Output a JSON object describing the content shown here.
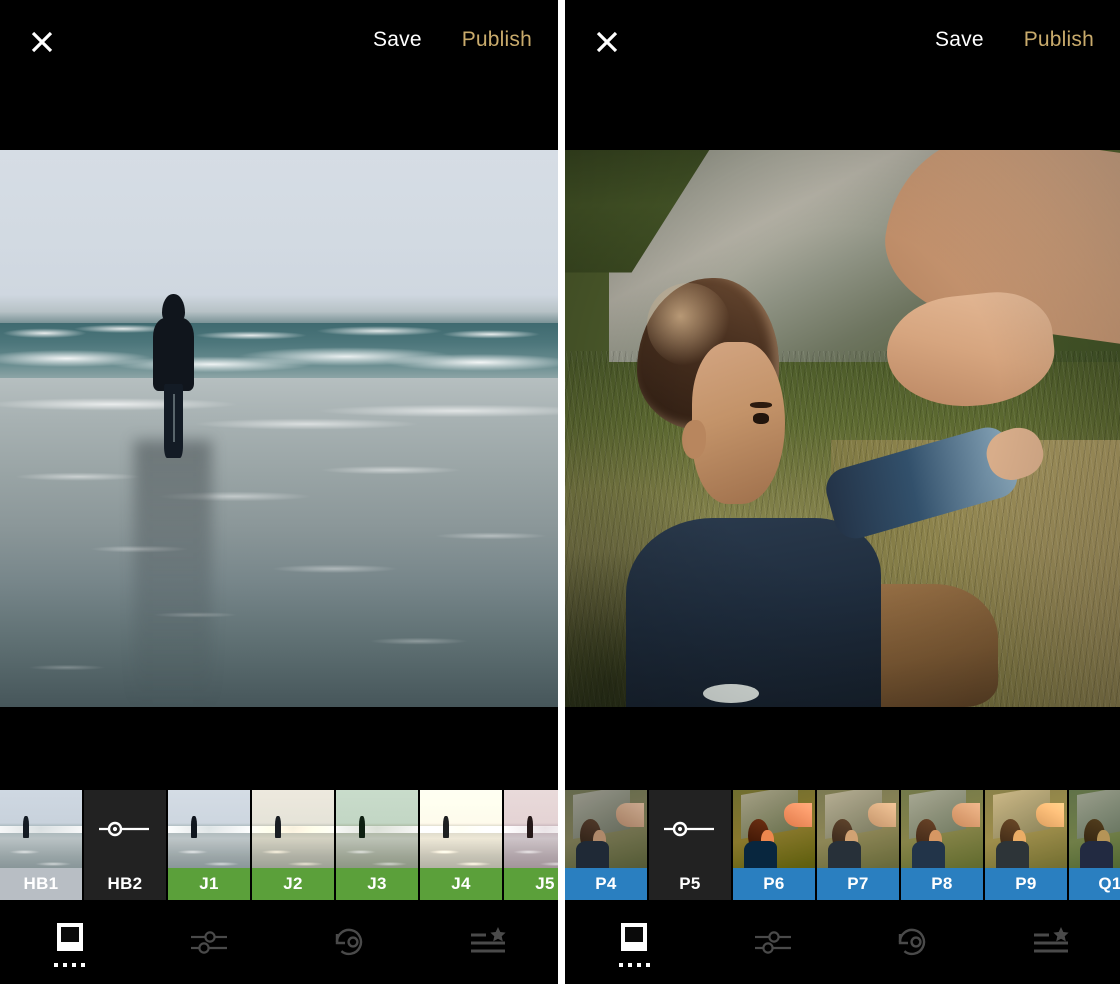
{
  "app": {
    "screens": [
      {
        "id": "screen-left",
        "header": {
          "close_icon": "close-icon",
          "save_label": "Save",
          "publish_label": "Publish"
        },
        "photo": {
          "subject": "person standing in ocean surf at beach",
          "type": "beach"
        },
        "filter_strip": {
          "tiles": [
            {
              "label": "HB1",
              "style": "selected",
              "label_color": "#b8bec4",
              "kind": "preset"
            },
            {
              "label": "HB2",
              "style": "slider",
              "label_color": "#222222",
              "kind": "strength-slider"
            },
            {
              "label": "J1",
              "style": "normal",
              "label_color": "#5ba03a",
              "kind": "preset"
            },
            {
              "label": "J2",
              "style": "normal",
              "label_color": "#5ba03a",
              "kind": "preset"
            },
            {
              "label": "J3",
              "style": "normal",
              "label_color": "#5ba03a",
              "kind": "preset"
            },
            {
              "label": "J4",
              "style": "normal",
              "label_color": "#5ba03a",
              "kind": "preset"
            },
            {
              "label": "J5",
              "style": "normal",
              "label_color": "#5ba03a",
              "kind": "preset"
            }
          ]
        },
        "toolbar": {
          "items": [
            {
              "icon": "presets-icon",
              "state": "active",
              "dots": 4
            },
            {
              "icon": "adjustments-sliders-icon",
              "state": "inactive"
            },
            {
              "icon": "undo-history-icon",
              "state": "inactive"
            },
            {
              "icon": "recipes-star-icon",
              "state": "inactive"
            }
          ]
        }
      },
      {
        "id": "screen-right",
        "header": {
          "close_icon": "close-icon",
          "save_label": "Save",
          "publish_label": "Publish"
        },
        "photo": {
          "subject": "toddler sitting on grass reaching for adult hand",
          "type": "child"
        },
        "filter_strip": {
          "tiles": [
            {
              "label": "P4",
              "style": "normal",
              "label_color": "#2a7fc0",
              "kind": "preset"
            },
            {
              "label": "P5",
              "style": "slider",
              "label_color": "#222222",
              "kind": "strength-slider"
            },
            {
              "label": "P6",
              "style": "normal",
              "label_color": "#2a7fc0",
              "kind": "preset"
            },
            {
              "label": "P7",
              "style": "normal",
              "label_color": "#2a7fc0",
              "kind": "preset"
            },
            {
              "label": "P8",
              "style": "normal",
              "label_color": "#2a7fc0",
              "kind": "preset"
            },
            {
              "label": "P9",
              "style": "normal",
              "label_color": "#2a7fc0",
              "kind": "preset"
            },
            {
              "label": "Q1",
              "style": "normal",
              "label_color": "#2a7fc0",
              "kind": "preset"
            }
          ]
        },
        "toolbar": {
          "items": [
            {
              "icon": "presets-icon",
              "state": "active",
              "dots": 4
            },
            {
              "icon": "adjustments-sliders-icon",
              "state": "inactive"
            },
            {
              "icon": "undo-history-icon",
              "state": "inactive"
            },
            {
              "icon": "recipes-star-icon",
              "state": "inactive"
            }
          ]
        }
      }
    ],
    "colors": {
      "background": "#000000",
      "publish_gold": "#c9ab6c",
      "save_white": "#ffffff",
      "label_green": "#5ba03a",
      "label_blue": "#2a7fc0",
      "label_silver": "#b8bec4",
      "slider_tile_bg": "#222222",
      "icon_active": "#ffffff",
      "icon_inactive": "#4a4a4a"
    }
  }
}
